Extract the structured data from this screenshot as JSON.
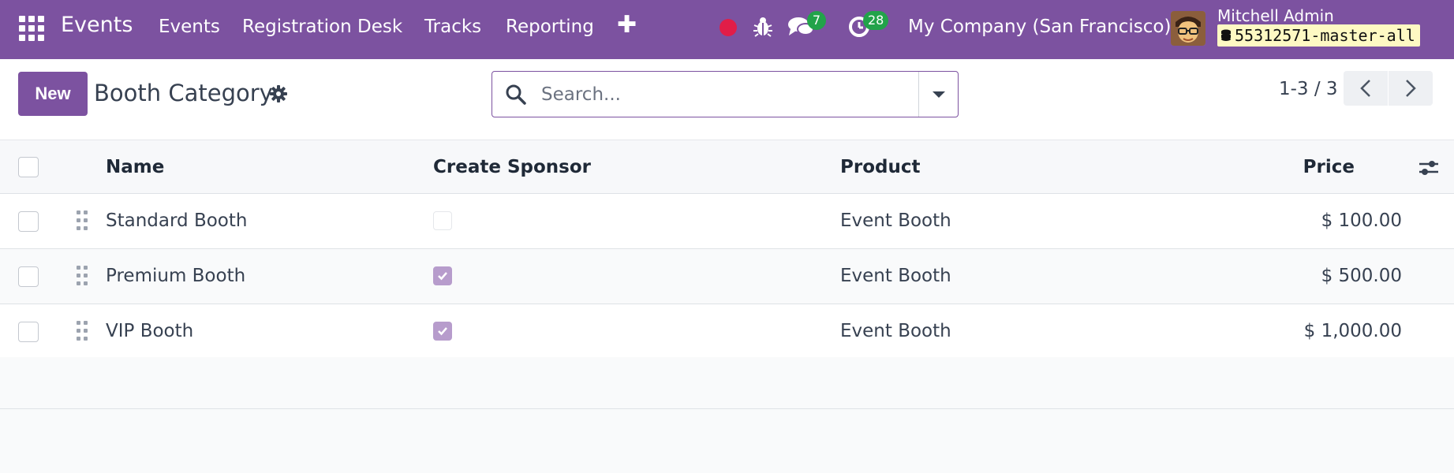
{
  "navbar": {
    "app_name": "Events",
    "menu": [
      "Events",
      "Registration Desk",
      "Tracks",
      "Reporting"
    ],
    "chat_badge": "7",
    "activity_badge": "28",
    "company": "My Company (San Francisco)",
    "user_name": "Mitchell Admin",
    "database": "55312571-master-all"
  },
  "control_panel": {
    "new_label": "New",
    "title": "Booth Category",
    "search_placeholder": "Search...",
    "pager": "1-3 / 3"
  },
  "table": {
    "headers": {
      "name": "Name",
      "create_sponsor": "Create Sponsor",
      "product": "Product",
      "price": "Price"
    },
    "rows": [
      {
        "name": "Standard Booth",
        "create_sponsor": false,
        "product": "Event Booth",
        "price": "$ 100.00"
      },
      {
        "name": "Premium Booth",
        "create_sponsor": true,
        "product": "Event Booth",
        "price": "$ 500.00"
      },
      {
        "name": "VIP Booth",
        "create_sponsor": true,
        "product": "Event Booth",
        "price": "$ 1,000.00"
      }
    ]
  },
  "colors": {
    "brand": "#7c52a0",
    "badge": "#22a34a",
    "record": "#e11d48",
    "checkbox_checked": "#b79ccc"
  }
}
